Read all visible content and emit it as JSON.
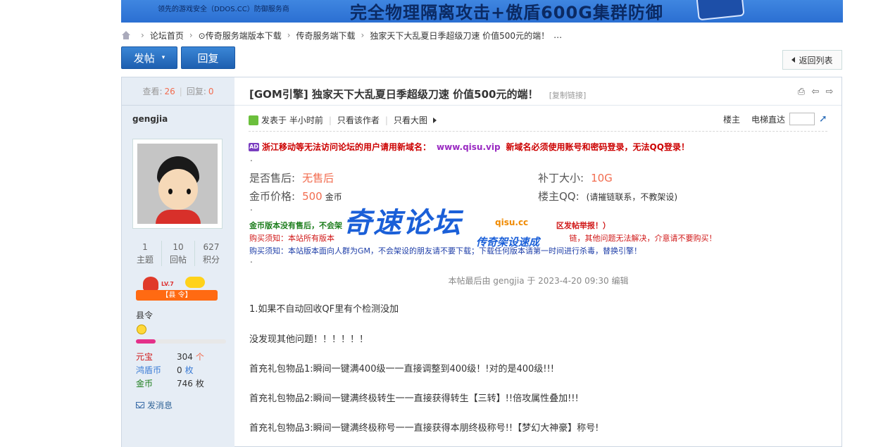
{
  "banner": {
    "small_text": "领先的游戏安全（DDOS.CC）防御服务商",
    "big_text": "完全物理隔离攻击+傲盾600G集群防御"
  },
  "breadcrumb": {
    "items": [
      "论坛首页",
      "⊙传奇服务端版本下载",
      "传奇服务端下载",
      "独家天下大乱夏日季超级刀速 价值500元的端！",
      "…"
    ]
  },
  "toolbar": {
    "post_label": "发帖",
    "reply_label": "回复",
    "back_label": "返回列表"
  },
  "sidebar": {
    "views_label": "查看:",
    "views": "26",
    "replies_label": "回复:",
    "replies": "0",
    "username": "gengjia",
    "stats": [
      {
        "value": "1",
        "label": "主题"
      },
      {
        "value": "10",
        "label": "回帖"
      },
      {
        "value": "627",
        "label": "积分"
      }
    ],
    "rank_lv": "LV.7",
    "rank_badge": "【县 令】",
    "rank_title": "县令",
    "currency": [
      {
        "key": "元宝",
        "value": "304",
        "unit": "个",
        "key_color": "#d01818",
        "unit_color": "#f26c4f"
      },
      {
        "key": "鸿盾币",
        "value": "0",
        "unit": "枚",
        "key_color": "#3a7bd5",
        "unit_color": "#3a7bd5"
      },
      {
        "key": "金币",
        "value": "746",
        "unit": "枚",
        "key_color": "#1c7d1c",
        "unit_color": "#333333"
      }
    ],
    "message_label": "发消息",
    "progress_fraction": 0.22
  },
  "post": {
    "title": "[GOM引擎] 独家天下大乱夏日季超级刀速 价值500元的端！",
    "copy_link": "[复制链接]",
    "posted_at": "发表于 半小时前",
    "author_only": "只看该作者",
    "large_image": "只看大图",
    "floor_owner": "楼主",
    "floor_jump": "电梯直达",
    "ad_text": "浙江移动等无法访问论坛的用户请用新域名：",
    "ad_url": "www.qisu.vip",
    "ad_tail": "新域名必须使用账号和密码登录，无法QQ登录！",
    "specs": {
      "aftersale_label": "是否售后:",
      "aftersale_value": "无售后",
      "patch_label": "补丁大小:",
      "patch_value": "10G",
      "price_label": "金币价格:",
      "price_value": "500",
      "price_unit": "金币",
      "qq_label": "楼主QQ:",
      "qq_value": "(请摧链联系，不教架设)"
    },
    "notice1_a": "金币版本没有售后，不会架",
    "notice1_b": "区发帖举报！）",
    "notice2": "购买须知：本站所有版本",
    "notice2_tail": "链，其他问题无法解决，介意请不要购买！",
    "notice3": "购买须知：本站版本面向人群为GM，不会架设的朋友请不要下载；下载任何版本请第一时间进行杀毒，替换引擎！",
    "watermark_main": "奇速论坛",
    "watermark_sub": "传奇架设速成",
    "watermark_tag": "qisu.cc",
    "edited_note": "本帖最后由 gengjia 于 2023-4-20 09:30 编辑",
    "body_lines": [
      "1.如果不自动回收QF里有个检测没加",
      "没发现其他问题！！！！！！",
      "首充礼包物品1:瞬间一键满400级一一直接调整到400级！!对的是400级!!!",
      "首充礼包物品2:瞬间一键满终极转生一一直接获得转生【三转】!!倍攻属性叠加!!!",
      "首充礼包物品3:瞬间一键满终极称号一一直接获得本朋终极称号!!【梦幻大神豪】称号!"
    ]
  }
}
